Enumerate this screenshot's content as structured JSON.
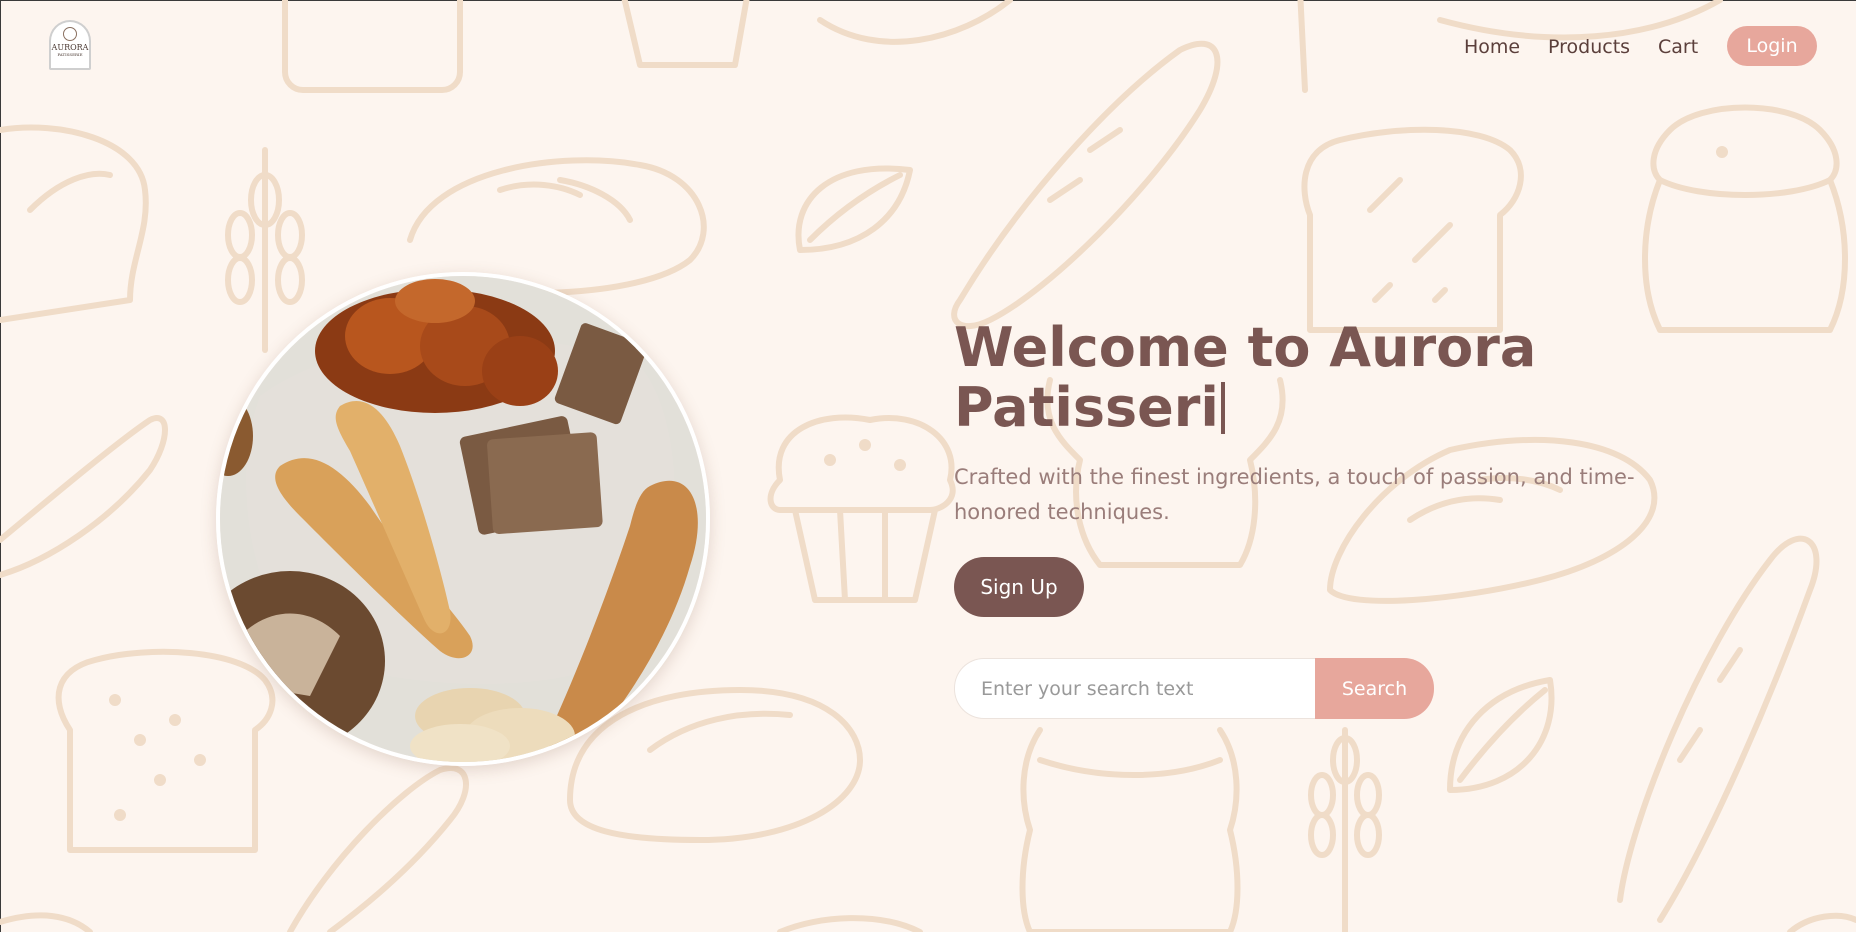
{
  "brand": {
    "logo_name": "AURORA",
    "logo_sub": "PATISSERIE"
  },
  "nav": {
    "items": [
      {
        "label": "Home"
      },
      {
        "label": "Products"
      },
      {
        "label": "Cart"
      }
    ],
    "login_label": "Login"
  },
  "hero": {
    "title_line1": "Welcome to Aurora",
    "title_line2": "Patisseri",
    "subtitle": "Crafted with the finest ingredients, a touch of passion, and time-honored techniques.",
    "signup_label": "Sign Up",
    "image_alt": "Assorted breads"
  },
  "search": {
    "placeholder": "Enter your search text",
    "value": "",
    "button_label": "Search"
  },
  "colors": {
    "background": "#fdf5ef",
    "doodle": "#f0dcc8",
    "primary": "#7a5652",
    "accent": "#e7a79c",
    "subtitle": "#9a7d7a"
  }
}
